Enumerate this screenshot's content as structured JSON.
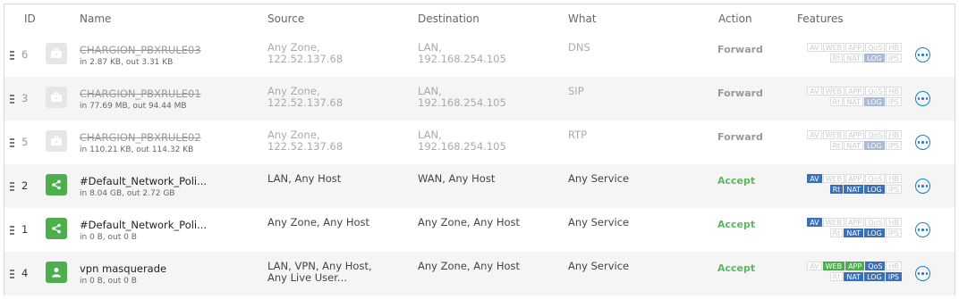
{
  "headers": {
    "id": "ID",
    "name": "Name",
    "source": "Source",
    "destination": "Destination",
    "what": "What",
    "action": "Action",
    "features": "Features"
  },
  "colors": {
    "accent": "#1a7dc5",
    "accept": "#5cb85c",
    "active_icon": "#4cae4c",
    "feature_blue": "#3c6fb5",
    "feature_green": "#4cae4c"
  },
  "rules": [
    {
      "id": "6",
      "enabled": false,
      "icon": "briefcase-icon",
      "name": "CHARGION_PBXRULE03",
      "stats": "in 2.87 KB, out 3.31 KB",
      "source": [
        "Any Zone,",
        "122.52.137.68"
      ],
      "destination": [
        "LAN,",
        "192.168.254.105"
      ],
      "what": "DNS",
      "action": "Forward",
      "features": [
        [
          {
            "t": "AV",
            "on": false
          },
          {
            "t": "WEB",
            "on": false
          },
          {
            "t": "APP",
            "on": false
          },
          {
            "t": "QoS",
            "on": false
          },
          {
            "t": "HB",
            "on": false
          }
        ],
        [
          {
            "t": "Rt",
            "on": false
          },
          {
            "t": "NAT",
            "on": false
          },
          {
            "t": "LOG",
            "on": true,
            "c": "#a8bbd6"
          },
          {
            "t": "IPS",
            "on": false
          }
        ]
      ]
    },
    {
      "id": "3",
      "enabled": false,
      "icon": "briefcase-icon",
      "name": "CHARGION_PBXRULE01",
      "stats": "in 77.69 MB, out 94.44 MB",
      "source": [
        "Any Zone,",
        "122.52.137.68"
      ],
      "destination": [
        "LAN,",
        "192.168.254.105"
      ],
      "what": "SIP",
      "action": "Forward",
      "features": [
        [
          {
            "t": "AV",
            "on": false
          },
          {
            "t": "WEB",
            "on": false
          },
          {
            "t": "APP",
            "on": false
          },
          {
            "t": "QoS",
            "on": false
          },
          {
            "t": "HB",
            "on": false
          }
        ],
        [
          {
            "t": "Rt",
            "on": false
          },
          {
            "t": "NAT",
            "on": false
          },
          {
            "t": "LOG",
            "on": true,
            "c": "#a8bbd6"
          },
          {
            "t": "IPS",
            "on": false
          }
        ]
      ]
    },
    {
      "id": "5",
      "enabled": false,
      "icon": "briefcase-icon",
      "name": "CHARGION_PBXRULE02",
      "stats": "in 110.21 KB, out 114.32 KB",
      "source": [
        "Any Zone,",
        "122.52.137.68"
      ],
      "destination": [
        "LAN,",
        "192.168.254.105"
      ],
      "what": "RTP",
      "action": "Forward",
      "features": [
        [
          {
            "t": "AV",
            "on": false
          },
          {
            "t": "WEB",
            "on": false
          },
          {
            "t": "APP",
            "on": false
          },
          {
            "t": "QoS",
            "on": false
          },
          {
            "t": "HB",
            "on": false
          }
        ],
        [
          {
            "t": "Rt",
            "on": false
          },
          {
            "t": "NAT",
            "on": false
          },
          {
            "t": "LOG",
            "on": true,
            "c": "#a8bbd6"
          },
          {
            "t": "IPS",
            "on": false
          }
        ]
      ]
    },
    {
      "id": "2",
      "enabled": true,
      "icon": "share-icon",
      "name": "#Default_Network_Poli...",
      "stats": "in 8.04 GB, out 2.72 GB",
      "source": [
        "LAN, Any Host"
      ],
      "destination": [
        "WAN, Any Host"
      ],
      "what": "Any Service",
      "action": "Accept",
      "features": [
        [
          {
            "t": "AV",
            "on": true,
            "c": "#3c6fb5"
          },
          {
            "t": "WEB",
            "on": false
          },
          {
            "t": "APP",
            "on": false
          },
          {
            "t": "QoS",
            "on": false
          },
          {
            "t": "HB",
            "on": false
          }
        ],
        [
          {
            "t": "Rt",
            "on": true,
            "c": "#3c6fb5"
          },
          {
            "t": "NAT",
            "on": true,
            "c": "#3c6fb5"
          },
          {
            "t": "LOG",
            "on": true,
            "c": "#3c6fb5"
          },
          {
            "t": "IPS",
            "on": false
          }
        ]
      ]
    },
    {
      "id": "1",
      "enabled": true,
      "icon": "share-icon",
      "name": "#Default_Network_Poli...",
      "stats": "in 0 B, out 0 B",
      "source": [
        "Any Zone, Any Host"
      ],
      "destination": [
        "Any Zone, Any Host"
      ],
      "what": "Any Service",
      "action": "Accept",
      "features": [
        [
          {
            "t": "AV",
            "on": true,
            "c": "#3c6fb5"
          },
          {
            "t": "WEB",
            "on": false
          },
          {
            "t": "APP",
            "on": false
          },
          {
            "t": "QoS",
            "on": false
          },
          {
            "t": "HB",
            "on": false
          }
        ],
        [
          {
            "t": "Rt",
            "on": false
          },
          {
            "t": "NAT",
            "on": true,
            "c": "#3c6fb5"
          },
          {
            "t": "LOG",
            "on": true,
            "c": "#3c6fb5"
          },
          {
            "t": "IPS",
            "on": false
          }
        ]
      ]
    },
    {
      "id": "4",
      "enabled": true,
      "icon": "user-icon",
      "name": "vpn masquerade",
      "stats": "in 0 B, out 0 B",
      "source": [
        "LAN, VPN, Any Host,",
        "Any Live User..."
      ],
      "destination": [
        "Any Zone, Any Host"
      ],
      "what": "Any Service",
      "action": "Accept",
      "features": [
        [
          {
            "t": "AV",
            "on": false
          },
          {
            "t": "WEB",
            "on": true,
            "c": "#4cae4c"
          },
          {
            "t": "APP",
            "on": true,
            "c": "#4cae4c"
          },
          {
            "t": "QoS",
            "on": true,
            "c": "#3c6fb5"
          },
          {
            "t": "HB",
            "on": false
          }
        ],
        [
          {
            "t": "Rt",
            "on": false
          },
          {
            "t": "NAT",
            "on": true,
            "c": "#3c6fb5"
          },
          {
            "t": "LOG",
            "on": true,
            "c": "#3c6fb5"
          },
          {
            "t": "IPS",
            "on": true,
            "c": "#3c6fb5"
          }
        ]
      ]
    }
  ]
}
